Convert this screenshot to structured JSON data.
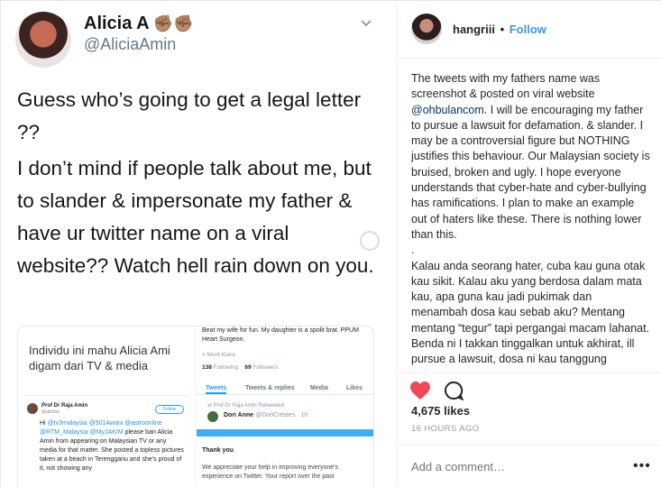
{
  "tweet": {
    "author_name": "Alicia A",
    "author_emoji": "✊🏽✊🏽",
    "author_handle": "@AliciaAmin",
    "paragraph_1": "Guess who’s going to get a legal letter ??",
    "paragraph_2": "I don’t mind if people talk about me, but to slander & impersonate my father & have ur twitter name on a viral website?? Watch hell rain down on you."
  },
  "media_left": {
    "title": "Individu ini mahu Alicia Ami digam dari TV & media",
    "author": "Prof Dr Raja Amin",
    "author_sub": "@abcfsa",
    "follow_label": "Follow",
    "body_pre": "Hi ",
    "body_links": "@tv3malaysia @501Awani @astroonline @RTM_Malaysia @MyJAKIM",
    "body_rest": " please ban Alicia Amin from appearing on Malaysian TV or any media for that matter. She posted a topless pictures taken at a beach in Terengganu and she's proud of it, not showing any"
  },
  "media_right": {
    "bio": "Beat my wife for fun. My daughter is a spolit brat. PPUM Heart Surgeon.",
    "location": "Mont Kiara",
    "following_count": "138",
    "following_label": "Following",
    "followers_count": "69",
    "followers_label": "Followers",
    "tabs": [
      "Tweets",
      "Tweets & replies",
      "Media",
      "Likes"
    ],
    "retweet_line": "Prof Dr Raja Amin Retweeted",
    "rt_name": "Dori Anne",
    "rt_handle": "@DoriCreates · 1h",
    "thank_you": "Thank you",
    "appreciate": "We appreciate your help in improving everyone's experience on Twitter. Your report over the past"
  },
  "instagram": {
    "username": "hangriii",
    "follow_label": "Follow",
    "caption_part1": "The tweets with my fathers name was screenshot & posted on viral website ",
    "caption_mention": "@ohbulancom",
    "caption_part2": ". I will be encouraging my father to pursue a lawsuit for defamation. & slander. I may be a controversial figure but NOTHING justifies this behaviour. Our Malaysian society is bruised, broken and ugly. I hope everyone understands that cyber-hate and cyber-bullying has ramifications. I plan to make an example out of haters like these. There is nothing lower than this.",
    "caption_dot": ".",
    "caption_part3": "Kalau anda seorang hater, cuba kau guna otak kau sikit. Kalau aku yang berdosa dalam mata kau, apa guna kau jadi pukimak dan menambah dosa kau sebab aku? Mentang mentang “tegur” tapi pergangai macam lahanat. Benda ni I takkan tinggalkan untuk akhirat, ill pursue a lawsuit, dosa ni kau tanggung sekarang.",
    "likes": "4,675 likes",
    "time": "16 HOURS AGO",
    "comment_placeholder": "Add a comment…",
    "more_label": "•••",
    "heart_color": "#ed4956",
    "link_color": "#3897f0"
  }
}
